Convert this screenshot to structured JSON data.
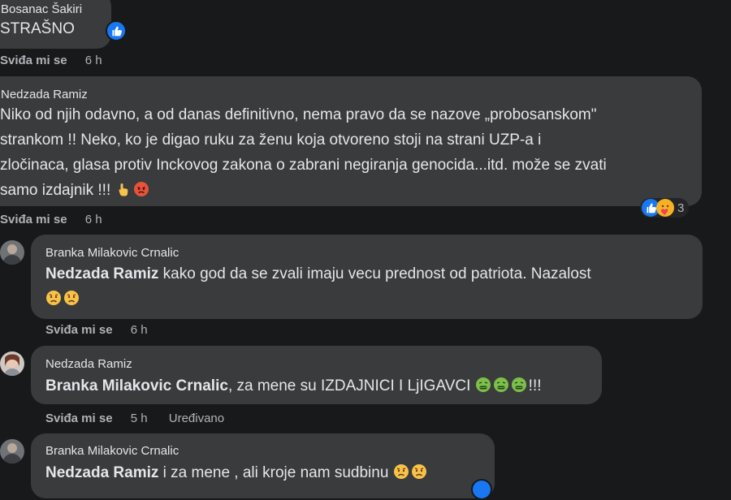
{
  "comments": [
    {
      "author": "Bosanac Šakiri",
      "text": "STRAŠNO",
      "like_label": "Sviđa mi se",
      "time": "6 h"
    },
    {
      "author": "Nedzada Ramiz",
      "lines": [
        "Niko od njih odavno, a od danas definitivno, nema pravo da se nazove „probosanskom\"",
        "strankom !! Neko, ko je digao ruku za ženu koja otvoreno stoji na strani UZP-a i",
        "zločinaca, glasa protiv Inckovog zakona o zabrani negiranja genocida...itd. može se zvati",
        "samo izdajnik !!!"
      ],
      "reaction_count": "3",
      "like_label": "Sviđa mi se",
      "time": "6 h"
    }
  ],
  "replies": [
    {
      "author": "Branka Milakovic Crnalic",
      "mention": "Nedzada Ramiz",
      "text": " kako god da se zvali imaju vecu prednost od patriota. Nazalost",
      "like_label": "Sviđa mi se",
      "time": "6 h"
    },
    {
      "author": "Nedzada Ramiz",
      "mention": "Branka Milakovic Crnalic",
      "text": ", za mene su IZDAJNICI I LjIGAVCI ",
      "tail": "!!!",
      "like_label": "Sviđa mi se",
      "time": "5 h",
      "edited": "Uređivano"
    },
    {
      "author": "Branka Milakovic Crnalic",
      "mention": "Nedzada Ramiz",
      "text": " i za mene , ali kroje nam sudbinu "
    }
  ],
  "colors": {
    "background": "#18191a",
    "bubble": "#3a3b3c",
    "meta_text": "#b0b3b8",
    "like_blue": "#1877f2"
  }
}
